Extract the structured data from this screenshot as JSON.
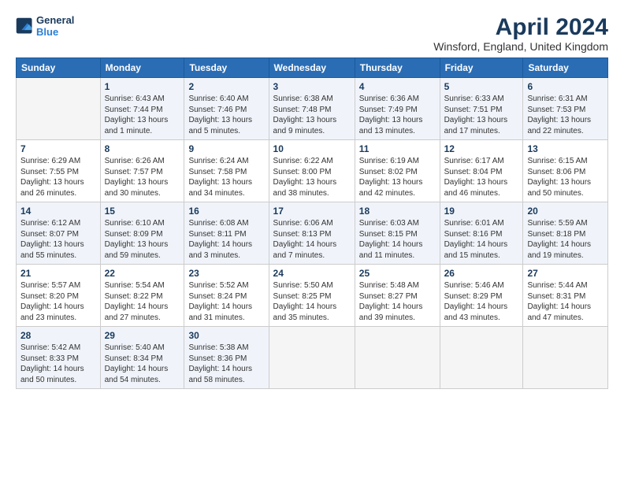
{
  "header": {
    "logo_line1": "General",
    "logo_line2": "Blue",
    "title": "April 2024",
    "subtitle": "Winsford, England, United Kingdom"
  },
  "days_of_week": [
    "Sunday",
    "Monday",
    "Tuesday",
    "Wednesday",
    "Thursday",
    "Friday",
    "Saturday"
  ],
  "weeks": [
    [
      {
        "num": "",
        "empty": true
      },
      {
        "num": "1",
        "sunrise": "Sunrise: 6:43 AM",
        "sunset": "Sunset: 7:44 PM",
        "daylight": "Daylight: 13 hours and 1 minute."
      },
      {
        "num": "2",
        "sunrise": "Sunrise: 6:40 AM",
        "sunset": "Sunset: 7:46 PM",
        "daylight": "Daylight: 13 hours and 5 minutes."
      },
      {
        "num": "3",
        "sunrise": "Sunrise: 6:38 AM",
        "sunset": "Sunset: 7:48 PM",
        "daylight": "Daylight: 13 hours and 9 minutes."
      },
      {
        "num": "4",
        "sunrise": "Sunrise: 6:36 AM",
        "sunset": "Sunset: 7:49 PM",
        "daylight": "Daylight: 13 hours and 13 minutes."
      },
      {
        "num": "5",
        "sunrise": "Sunrise: 6:33 AM",
        "sunset": "Sunset: 7:51 PM",
        "daylight": "Daylight: 13 hours and 17 minutes."
      },
      {
        "num": "6",
        "sunrise": "Sunrise: 6:31 AM",
        "sunset": "Sunset: 7:53 PM",
        "daylight": "Daylight: 13 hours and 22 minutes."
      }
    ],
    [
      {
        "num": "7",
        "sunrise": "Sunrise: 6:29 AM",
        "sunset": "Sunset: 7:55 PM",
        "daylight": "Daylight: 13 hours and 26 minutes."
      },
      {
        "num": "8",
        "sunrise": "Sunrise: 6:26 AM",
        "sunset": "Sunset: 7:57 PM",
        "daylight": "Daylight: 13 hours and 30 minutes."
      },
      {
        "num": "9",
        "sunrise": "Sunrise: 6:24 AM",
        "sunset": "Sunset: 7:58 PM",
        "daylight": "Daylight: 13 hours and 34 minutes."
      },
      {
        "num": "10",
        "sunrise": "Sunrise: 6:22 AM",
        "sunset": "Sunset: 8:00 PM",
        "daylight": "Daylight: 13 hours and 38 minutes."
      },
      {
        "num": "11",
        "sunrise": "Sunrise: 6:19 AM",
        "sunset": "Sunset: 8:02 PM",
        "daylight": "Daylight: 13 hours and 42 minutes."
      },
      {
        "num": "12",
        "sunrise": "Sunrise: 6:17 AM",
        "sunset": "Sunset: 8:04 PM",
        "daylight": "Daylight: 13 hours and 46 minutes."
      },
      {
        "num": "13",
        "sunrise": "Sunrise: 6:15 AM",
        "sunset": "Sunset: 8:06 PM",
        "daylight": "Daylight: 13 hours and 50 minutes."
      }
    ],
    [
      {
        "num": "14",
        "sunrise": "Sunrise: 6:12 AM",
        "sunset": "Sunset: 8:07 PM",
        "daylight": "Daylight: 13 hours and 55 minutes."
      },
      {
        "num": "15",
        "sunrise": "Sunrise: 6:10 AM",
        "sunset": "Sunset: 8:09 PM",
        "daylight": "Daylight: 13 hours and 59 minutes."
      },
      {
        "num": "16",
        "sunrise": "Sunrise: 6:08 AM",
        "sunset": "Sunset: 8:11 PM",
        "daylight": "Daylight: 14 hours and 3 minutes."
      },
      {
        "num": "17",
        "sunrise": "Sunrise: 6:06 AM",
        "sunset": "Sunset: 8:13 PM",
        "daylight": "Daylight: 14 hours and 7 minutes."
      },
      {
        "num": "18",
        "sunrise": "Sunrise: 6:03 AM",
        "sunset": "Sunset: 8:15 PM",
        "daylight": "Daylight: 14 hours and 11 minutes."
      },
      {
        "num": "19",
        "sunrise": "Sunrise: 6:01 AM",
        "sunset": "Sunset: 8:16 PM",
        "daylight": "Daylight: 14 hours and 15 minutes."
      },
      {
        "num": "20",
        "sunrise": "Sunrise: 5:59 AM",
        "sunset": "Sunset: 8:18 PM",
        "daylight": "Daylight: 14 hours and 19 minutes."
      }
    ],
    [
      {
        "num": "21",
        "sunrise": "Sunrise: 5:57 AM",
        "sunset": "Sunset: 8:20 PM",
        "daylight": "Daylight: 14 hours and 23 minutes."
      },
      {
        "num": "22",
        "sunrise": "Sunrise: 5:54 AM",
        "sunset": "Sunset: 8:22 PM",
        "daylight": "Daylight: 14 hours and 27 minutes."
      },
      {
        "num": "23",
        "sunrise": "Sunrise: 5:52 AM",
        "sunset": "Sunset: 8:24 PM",
        "daylight": "Daylight: 14 hours and 31 minutes."
      },
      {
        "num": "24",
        "sunrise": "Sunrise: 5:50 AM",
        "sunset": "Sunset: 8:25 PM",
        "daylight": "Daylight: 14 hours and 35 minutes."
      },
      {
        "num": "25",
        "sunrise": "Sunrise: 5:48 AM",
        "sunset": "Sunset: 8:27 PM",
        "daylight": "Daylight: 14 hours and 39 minutes."
      },
      {
        "num": "26",
        "sunrise": "Sunrise: 5:46 AM",
        "sunset": "Sunset: 8:29 PM",
        "daylight": "Daylight: 14 hours and 43 minutes."
      },
      {
        "num": "27",
        "sunrise": "Sunrise: 5:44 AM",
        "sunset": "Sunset: 8:31 PM",
        "daylight": "Daylight: 14 hours and 47 minutes."
      }
    ],
    [
      {
        "num": "28",
        "sunrise": "Sunrise: 5:42 AM",
        "sunset": "Sunset: 8:33 PM",
        "daylight": "Daylight: 14 hours and 50 minutes."
      },
      {
        "num": "29",
        "sunrise": "Sunrise: 5:40 AM",
        "sunset": "Sunset: 8:34 PM",
        "daylight": "Daylight: 14 hours and 54 minutes."
      },
      {
        "num": "30",
        "sunrise": "Sunrise: 5:38 AM",
        "sunset": "Sunset: 8:36 PM",
        "daylight": "Daylight: 14 hours and 58 minutes."
      },
      {
        "num": "",
        "empty": true
      },
      {
        "num": "",
        "empty": true
      },
      {
        "num": "",
        "empty": true
      },
      {
        "num": "",
        "empty": true
      }
    ]
  ]
}
